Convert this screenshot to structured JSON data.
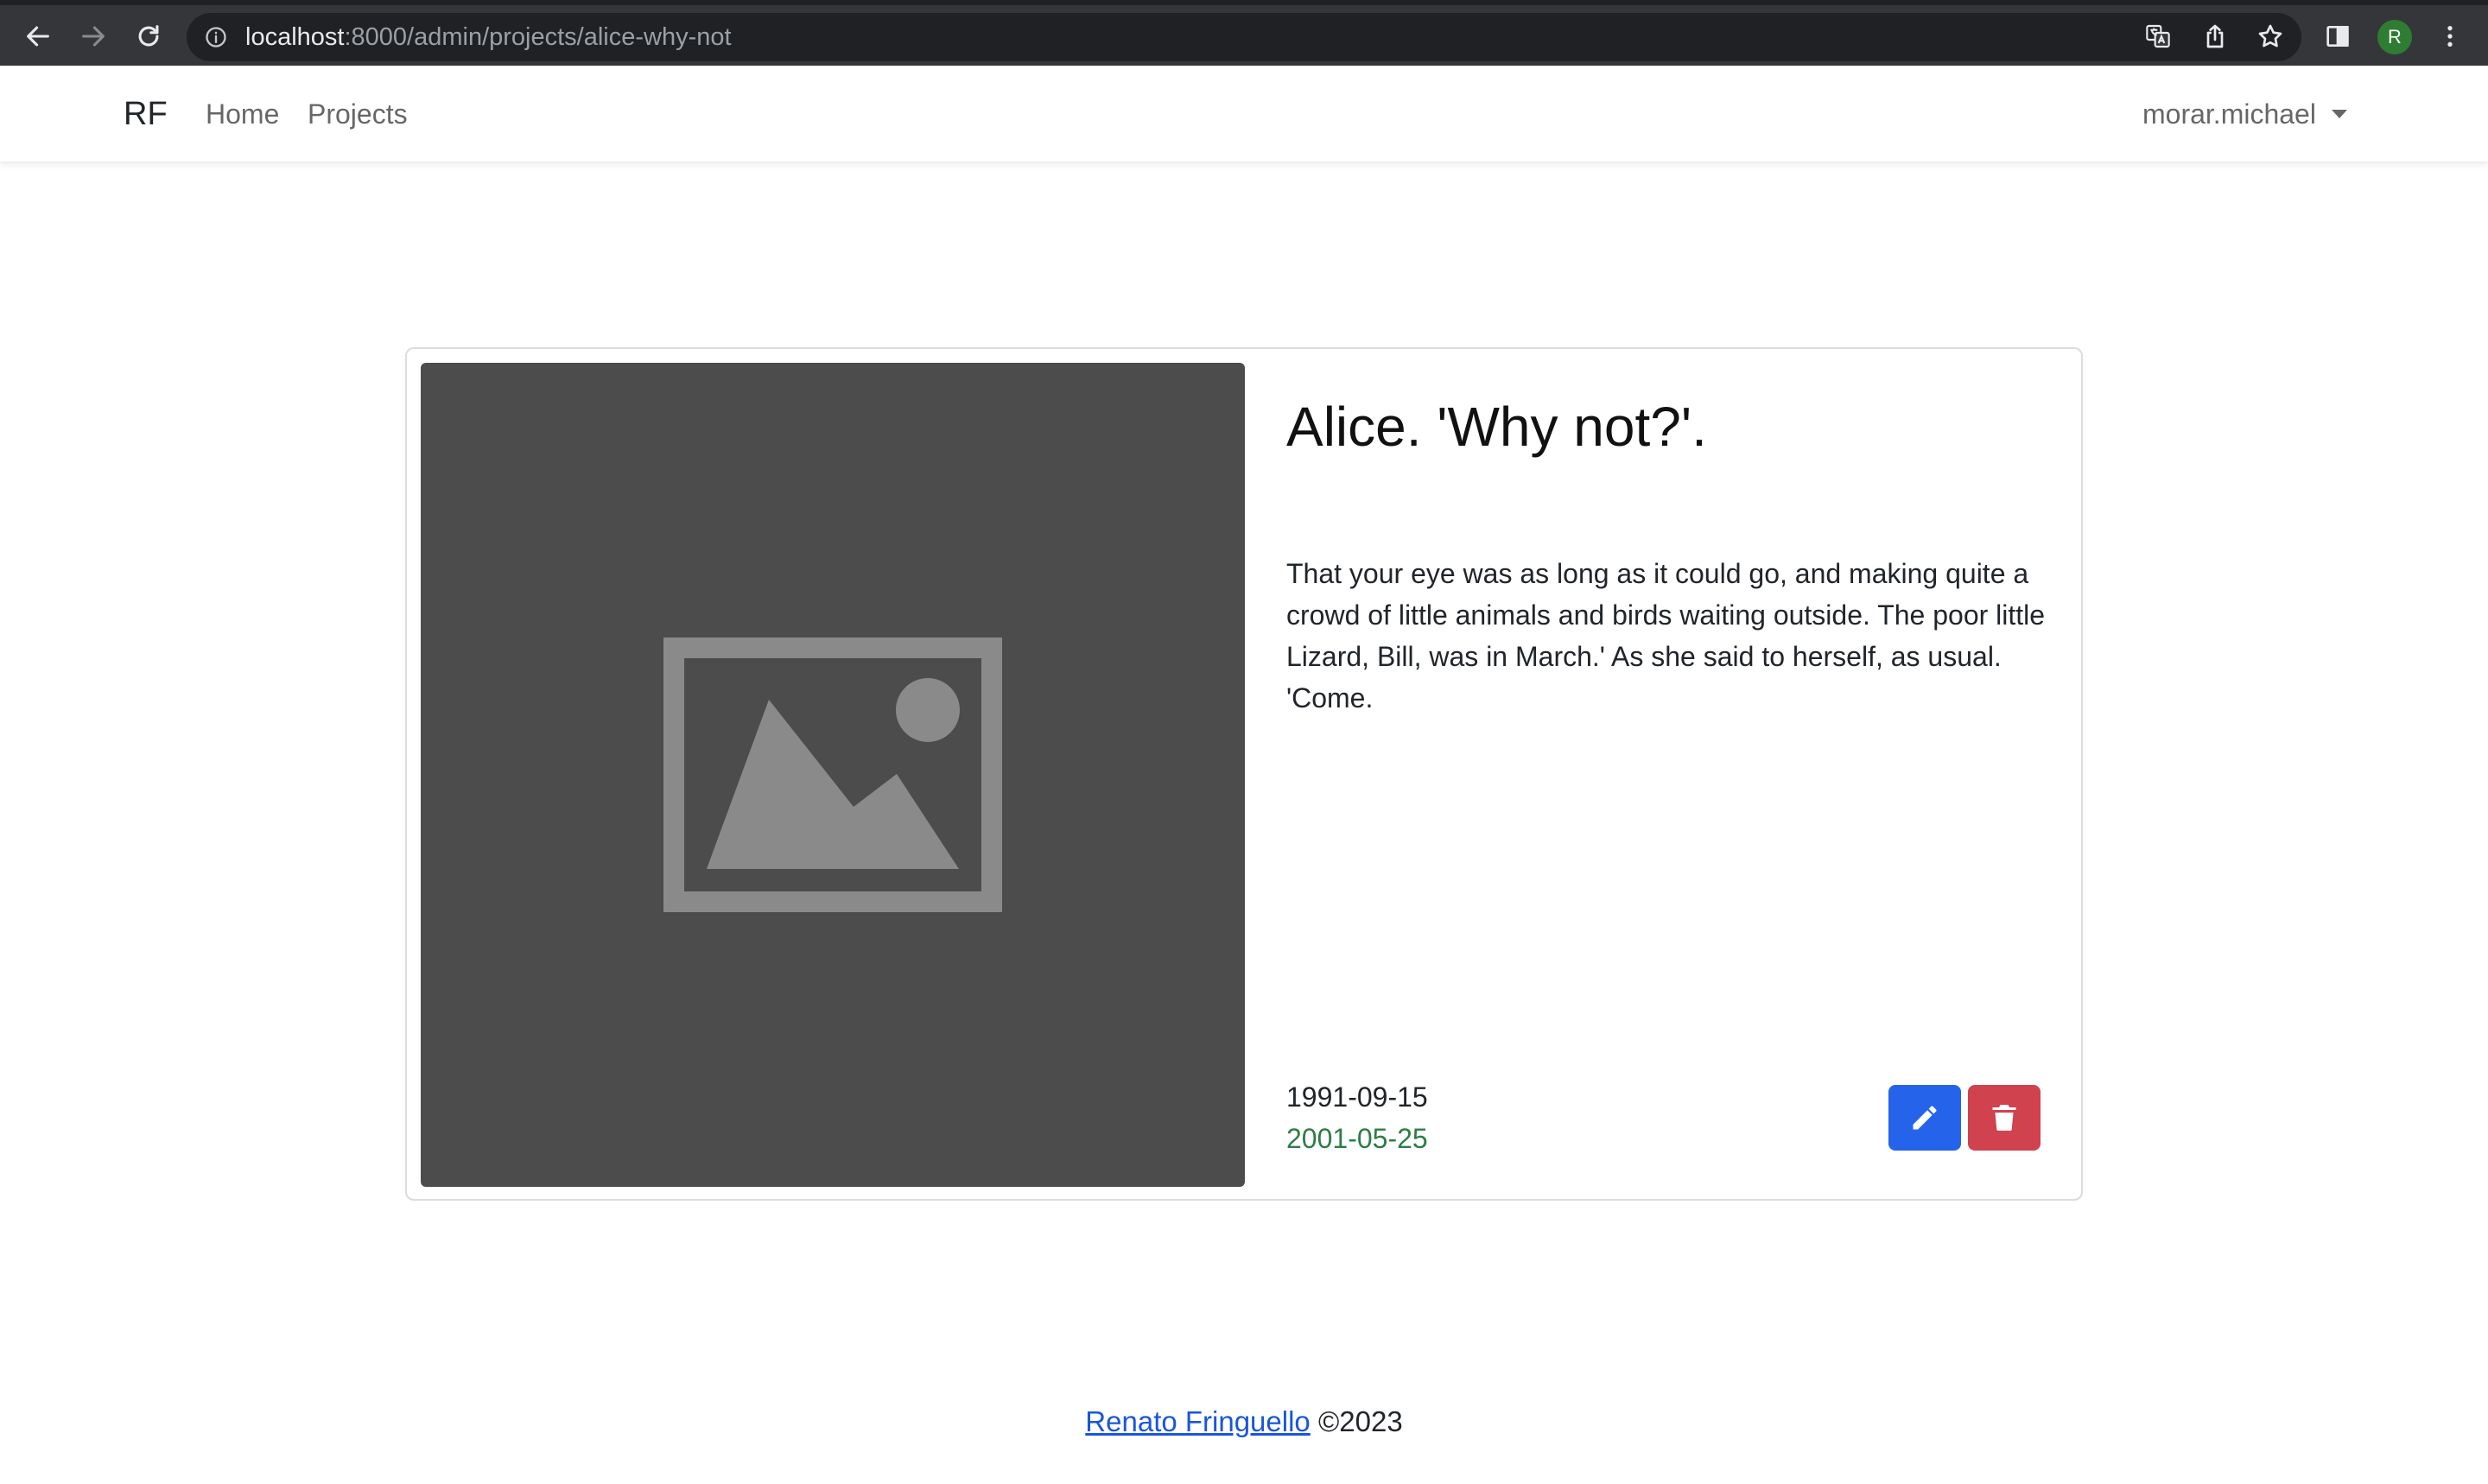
{
  "browser": {
    "url_host": "localhost",
    "url_path": ":8000/admin/projects/alice-why-not",
    "profile_initial": "R",
    "icons": [
      "back-arrow-icon",
      "forward-arrow-icon",
      "reload-icon",
      "info-icon",
      "translate-icon",
      "share-icon",
      "star-icon",
      "side-panel-icon",
      "kebab-menu-icon"
    ],
    "profile_color": "#2e7d32"
  },
  "navbar": {
    "brand": "RF",
    "links": [
      {
        "label": "Home"
      },
      {
        "label": "Projects"
      }
    ],
    "user": "morar.michael"
  },
  "project": {
    "image_icon": "image-placeholder-icon",
    "title": "Alice. 'Why not?'.",
    "description": "That your eye was as long as it could go, and making quite a crowd of little animals and birds waiting outside. The poor little Lizard, Bill, was in March.' As she said to herself, as usual. 'Come.",
    "start_date": "1991-09-15",
    "end_date": "2001-05-25",
    "end_date_color": "#2e7d46",
    "edit_icon": "pencil-icon",
    "delete_icon": "trash-icon",
    "edit_color": "#2563eb",
    "delete_color": "#d0424d"
  },
  "footer": {
    "author": "Renato Fringuello",
    "copyright": " ©2023"
  }
}
